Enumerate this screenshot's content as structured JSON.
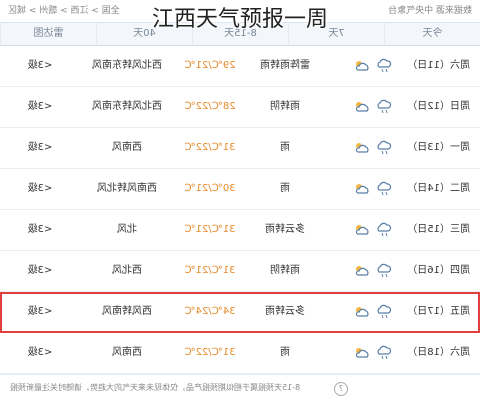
{
  "title": "江西天气预报一周",
  "top": {
    "source": "数据来源 中央气象台",
    "breadcrumb": "全国 > 江西 > 赣州 > 城区"
  },
  "tabs": [
    "今天",
    "7天",
    "8-15天",
    "40天",
    "雷达图"
  ],
  "rows": [
    {
      "date": "周六（11日）",
      "desc": "雷阵雨转雨",
      "temp": "29℃/21℃",
      "wind": "西北风转东南风",
      "level": "<3级",
      "selected": false
    },
    {
      "date": "周日（12日）",
      "desc": "雨转阴",
      "temp": "28℃/22℃",
      "wind": "西北风转东南风",
      "level": "<3级",
      "selected": false
    },
    {
      "date": "周一（13日）",
      "desc": "雨",
      "temp": "31℃/22℃",
      "wind": "西南风",
      "level": "<3级",
      "selected": false
    },
    {
      "date": "周二（14日）",
      "desc": "雨",
      "temp": "30℃/21℃",
      "wind": "西南风转北风",
      "level": "<3级",
      "selected": false
    },
    {
      "date": "周三（15日）",
      "desc": "多云转雨",
      "temp": "31℃/21℃",
      "wind": "北风",
      "level": "<3级",
      "selected": false
    },
    {
      "date": "周四（16日）",
      "desc": "雨转阴",
      "temp": "31℃/21℃",
      "wind": "西北风",
      "level": "<3级",
      "selected": false
    },
    {
      "date": "周五（17日）",
      "desc": "多云转雨",
      "temp": "34℃/24℃",
      "wind": "西风转南风",
      "level": "<3级",
      "selected": true
    },
    {
      "date": "周六（18日）",
      "desc": "雨",
      "temp": "31℃/22℃",
      "wind": "西南风",
      "level": "<3级",
      "selected": false
    }
  ],
  "footer": {
    "note": "8-15天预报属于相似期预报产品，仅体现未来天气的大趋势，请随时关注最新预报"
  },
  "colors": {
    "temp": "#e88a2a",
    "selected_outline": "#e04040"
  }
}
